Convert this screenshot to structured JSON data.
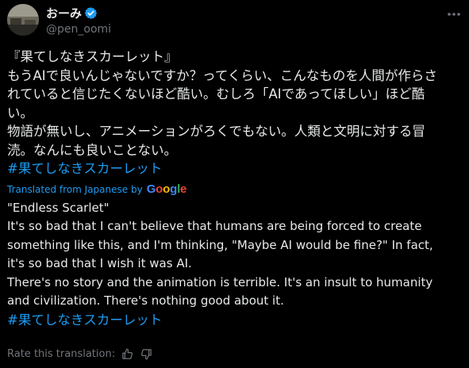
{
  "author": {
    "display_name": "おーみ",
    "handle": "@pen_oomi",
    "verified_icon": "verified-badge-icon",
    "badge_color": "#1d9bf0"
  },
  "more_icon": "more-options-icon",
  "original": {
    "lines": [
      "『果てしなきスカーレット』",
      "もうAIで良いんじゃないですか？ってくらい、こんなものを人間が作らさ",
      "れていると信じたくないほど酷い。むしろ「AIであってほしい」ほど酷",
      "い。",
      "物語が無いし、アニメーションがろくでもない。人類と文明に対する冒",
      "涜。なんにも良いことない。"
    ],
    "hashtag": "#果てしなきスカーレット"
  },
  "translation": {
    "label": "Translated from Japanese by",
    "provider": "Google",
    "lines": [
      "\"Endless Scarlet\"",
      "It's so bad that I can't believe that humans are being forced to create",
      "something like this, and I'm thinking, \"Maybe AI would be fine?\" In fact,",
      "it's so bad that I wish it was AI.",
      "There's no story and the animation is terrible. It's an insult to humanity",
      "and civilization. There's nothing good about it."
    ],
    "hashtag": "#果てしなきスカーレット"
  },
  "rating": {
    "label": "Rate this translation:",
    "up_icon": "thumbs-up-icon",
    "down_icon": "thumbs-down-icon"
  },
  "colors": {
    "background": "#000000",
    "text": "#e7e9ea",
    "secondary": "#71767b",
    "accent": "#1d9bf0"
  }
}
